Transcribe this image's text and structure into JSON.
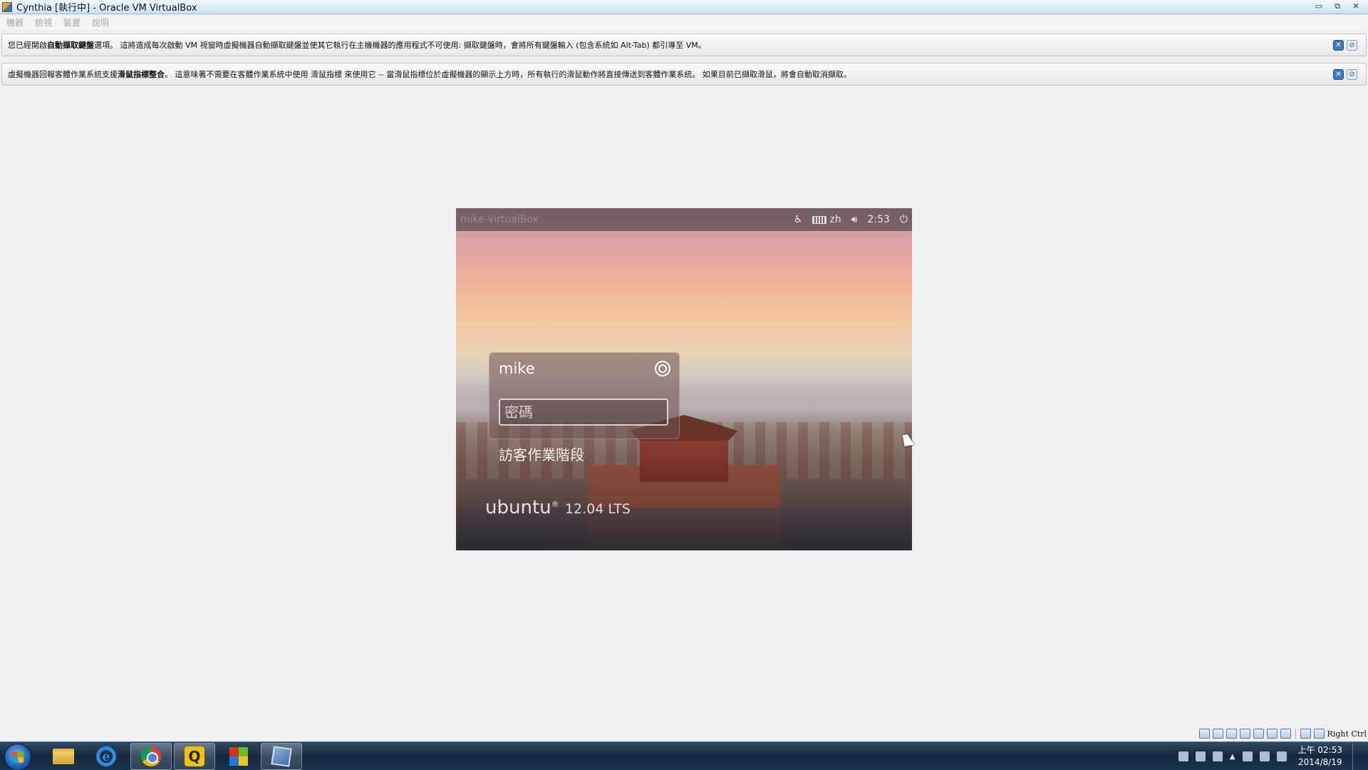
{
  "window": {
    "title": "Cynthia [執行中] - Oracle VM VirtualBox",
    "minimize": "▭",
    "maximize": "⧉",
    "close": "✕"
  },
  "menu": {
    "items": [
      "機器",
      "檢視",
      "裝置",
      "說明"
    ]
  },
  "notices": [
    {
      "pre": "您已經開啟",
      "bold": "自動擷取鍵盤",
      "post": "選項。 這將造成每次啟動 VM 視窗時虛擬機器自動擷取鍵盤並使其它執行在主機機器的應用程式不可使用: 擷取鍵盤時，會將所有鍵盤輸入 (包含系統如 Alt-Tab) 都引導至 VM。"
    },
    {
      "pre": "虛擬機器回報客體作業系統支援",
      "bold": "滑鼠指標整合",
      "post": "。 這意味著不需要在客體作業系統中使用 滑鼠指標 來使用它 -- 當滑鼠指標位於虛擬機器的顯示上方時，所有執行的滑鼠動作將直接傳送到客體作業系統。 如果目前已擷取滑鼠，將會自動取消擷取。"
    }
  ],
  "vm": {
    "hostname": "mike-VirtualBox",
    "keyboard_layout": "zh",
    "time": "2:53",
    "username": "mike",
    "password_placeholder": "密碼",
    "guest_session": "訪客作業階段",
    "os_name": "ubuntu",
    "os_mark": "®",
    "os_version": "12.04 LTS"
  },
  "status_bar": {
    "host_key": "Right Ctrl"
  },
  "taskbar": {
    "ie_letter": "e",
    "q_letter": "Q",
    "clock_time": "上午 02:53",
    "clock_date": "2014/8/19"
  },
  "colors": {
    "titlebar": "#c9e2f2",
    "taskbar": "#15293d",
    "notice_background": "#f0f0f0"
  },
  "icons": [
    "virtualbox-app-icon",
    "accessibility-icon",
    "keyboard-icon",
    "volume-icon",
    "power-icon",
    "session-gear-icon",
    "start-orb-icon",
    "folder-icon",
    "internet-explorer-icon",
    "chrome-icon",
    "q-app-icon",
    "office-icon",
    "virtualbox-icon"
  ]
}
